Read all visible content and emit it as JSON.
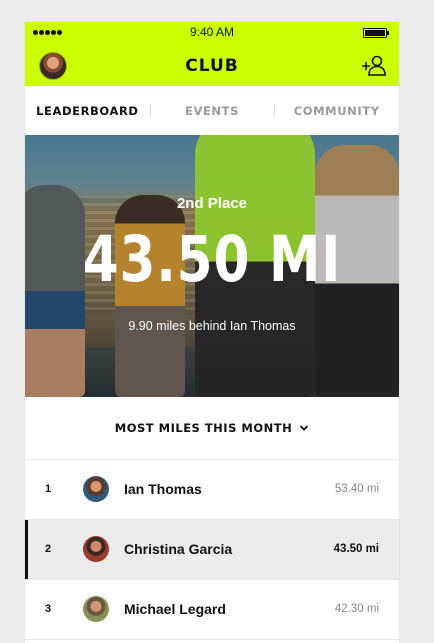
{
  "status_bar": {
    "time": "9:40 AM"
  },
  "header": {
    "title": "CLUB"
  },
  "tabs": [
    {
      "label": "LEADERBOARD",
      "active": true
    },
    {
      "label": "EVENTS",
      "active": false
    },
    {
      "label": "COMMUNITY",
      "active": false
    }
  ],
  "hero": {
    "place": "2nd Place",
    "distance": "43.50 MI",
    "behind_text": "9.90 miles behind Ian Thomas"
  },
  "filter": {
    "label": "MOST MILES THIS MONTH"
  },
  "leaderboard": [
    {
      "rank": "1",
      "name": "Ian Thomas",
      "miles": "53.40 mi"
    },
    {
      "rank": "2",
      "name": "Christina Garcia",
      "miles": "43.50 mi",
      "current_user": true
    },
    {
      "rank": "3",
      "name": "Michael Legard",
      "miles": "42.30 mi"
    }
  ],
  "colors": {
    "accent": "#ccff00",
    "highlight_row": "#ececec"
  },
  "icons": [
    "signal-icon",
    "battery-icon",
    "avatar",
    "add-user-icon",
    "chevron-down-icon"
  ]
}
